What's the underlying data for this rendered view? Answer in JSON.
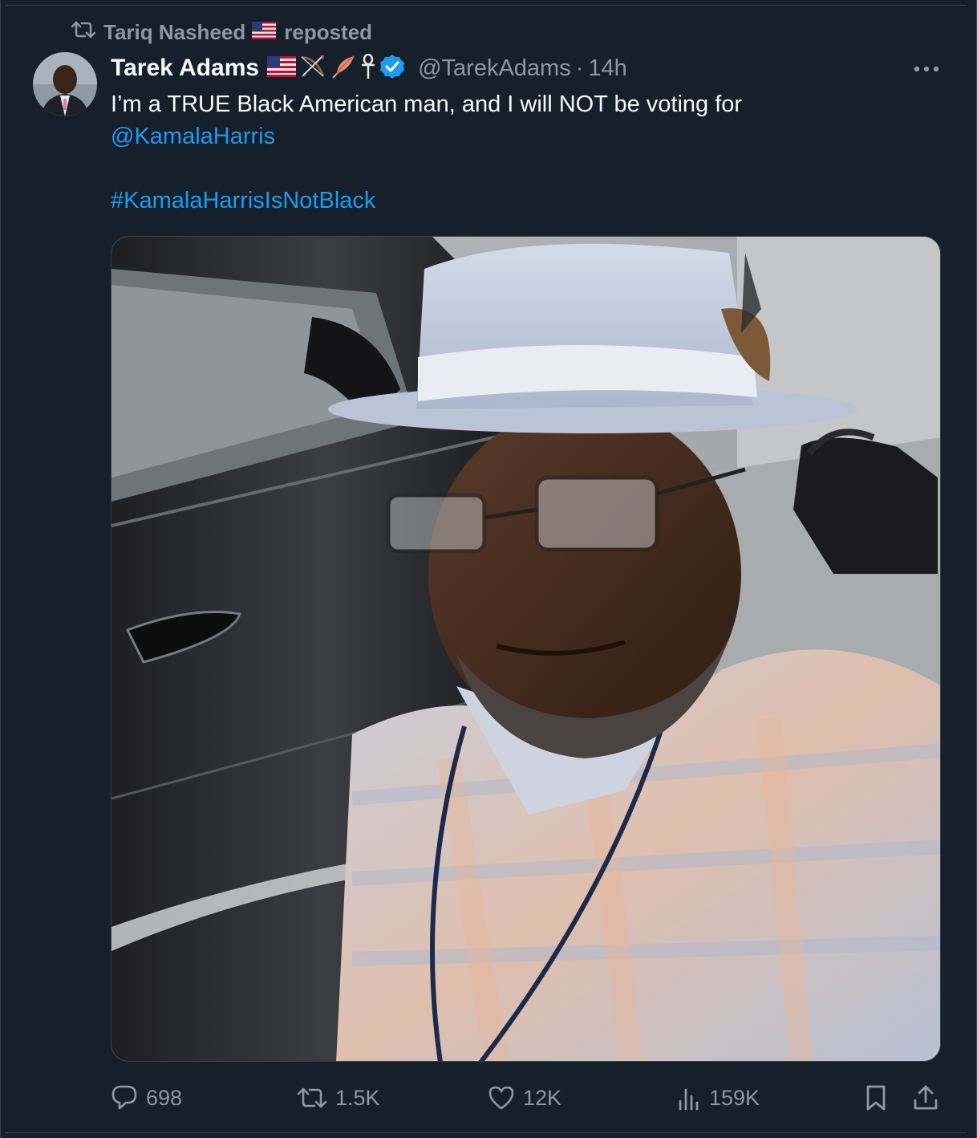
{
  "repost": {
    "icon": "repost-icon",
    "reposter_name": "Tariq Nasheed",
    "label": "reposted"
  },
  "tweet": {
    "display_name": "Tarek Adams",
    "handle": "@TarekAdams",
    "separator": "·",
    "time": "14h",
    "verified_color": "#1d9bf0",
    "name_emojis": [
      "us-flag-icon",
      "bow-and-arrow-icon",
      "feather-icon",
      "ankh-icon"
    ],
    "text_line1": "I’m a TRUE Black American man, and I will NOT be voting for",
    "mention": "@KamalaHarris",
    "hashtag": "#KamalaHarrisIsNotBlack"
  },
  "actions": {
    "replies": "698",
    "reposts": "1.5K",
    "likes": "12K",
    "views": "159K"
  },
  "colors": {
    "background": "#15202b",
    "text": "#f7f9f9",
    "muted": "#8b98a5",
    "link": "#1d9bf0",
    "border": "#38444d"
  }
}
